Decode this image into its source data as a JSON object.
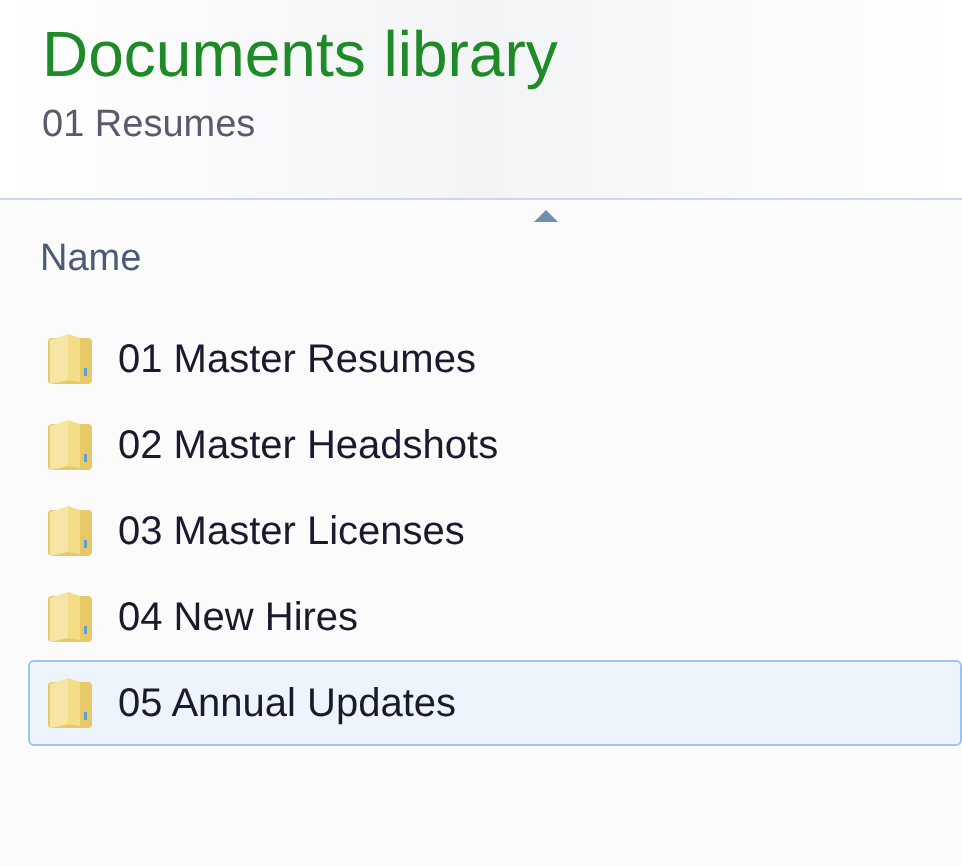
{
  "header": {
    "title": "Documents library",
    "subtitle": "01 Resumes"
  },
  "columns": [
    {
      "label": "Name"
    }
  ],
  "items": [
    {
      "name": "01 Master Resumes",
      "selected": false
    },
    {
      "name": "02 Master Headshots",
      "selected": false
    },
    {
      "name": "03 Master Licenses",
      "selected": false
    },
    {
      "name": "04 New Hires",
      "selected": false
    },
    {
      "name": "05 Annual Updates",
      "selected": true
    }
  ]
}
